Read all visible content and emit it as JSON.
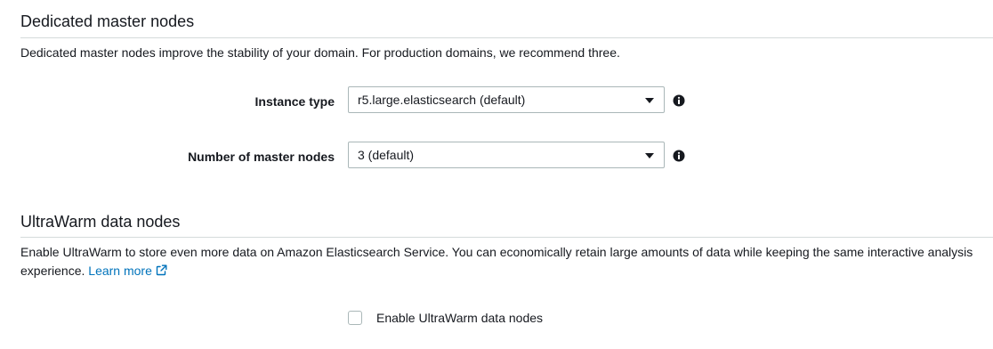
{
  "dedicated_master": {
    "title": "Dedicated master nodes",
    "description": "Dedicated master nodes improve the stability of your domain. For production domains, we recommend three.",
    "instance_type": {
      "label": "Instance type",
      "value": "r5.large.elasticsearch (default)",
      "info_icon": "info-icon"
    },
    "master_count": {
      "label": "Number of master nodes",
      "value": "3 (default)",
      "info_icon": "info-icon"
    }
  },
  "ultrawarm": {
    "title": "UltraWarm data nodes",
    "description": "Enable UltraWarm to store even more data on Amazon Elasticsearch Service. You can economically retain large amounts of data while keeping the same interactive analysis experience.",
    "learn_more": "Learn more",
    "learn_more_icon": "external-link-icon",
    "enable_checkbox": {
      "label": "Enable UltraWarm data nodes",
      "checked": false
    }
  },
  "colors": {
    "link": "#0073bb",
    "text": "#16191f",
    "border": "#aab7b8",
    "divider": "#d5dbdb"
  }
}
